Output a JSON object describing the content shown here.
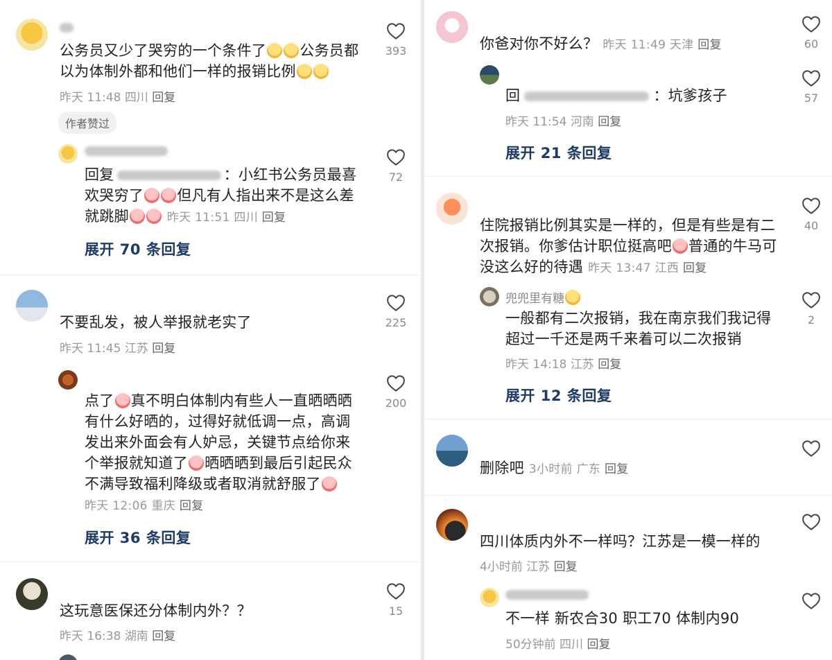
{
  "heart_color": "#444444",
  "expand_color": "#1e3a66",
  "left": {
    "c1": {
      "text": "公务员又少了哭穷的一个条件了",
      "text2": "公务员都以为体制外都和他们一样的报销比例",
      "time": "昨天 11:48",
      "place": "四川",
      "reply": "回复",
      "likes": "393",
      "author_tag": "作者赞过"
    },
    "c1r": {
      "prefix": "回复",
      "text": "：小红书公务员最喜欢哭穷了",
      "text2": "但凡有人指出来不是这么差就跳脚",
      "time": "昨天 11:51",
      "place": "四川",
      "reply": "回复",
      "likes": "72",
      "expand": "展开 70 条回复"
    },
    "c2": {
      "text": "不要乱发，被人举报就老实了",
      "time": "昨天 11:45",
      "place": "江苏",
      "reply": "回复",
      "likes": "225"
    },
    "c2r": {
      "text_a": "点了",
      "text_b": "真不明白体制内有些人一直晒晒晒有什么好晒的，过得好就低调一点，高调发出来外面会有人妒忌，关键节点给你来个举报就知道了",
      "text_c": "晒晒晒到最后引起民众不满导致福利降级或者取消就舒服了",
      "time": "昨天 12:06",
      "place": "重庆",
      "reply": "回复",
      "likes": "200",
      "expand": "展开 36 条回复"
    },
    "c3": {
      "text": "这玩意医保还分体制内外？？",
      "time": "昨天 16:38",
      "place": "湖南",
      "reply": "回复",
      "likes": "15"
    }
  },
  "right": {
    "c1": {
      "text": "你爸对你不好么？",
      "time": "昨天 11:49",
      "place": "天津",
      "reply": "回复",
      "likes": "60"
    },
    "c1r": {
      "prefix": "回",
      "text": "：坑爹孩子",
      "time": "昨天 11:54",
      "place": "河南",
      "reply": "回复",
      "likes": "57",
      "expand": "展开 21 条回复"
    },
    "c2": {
      "text": "住院报销比例其实是一样的，但是有些是有二次报销。你爹估计职位挺高吧",
      "text2": "普通的牛马可没这么好的待遇",
      "time": "昨天 13:47",
      "place": "江西",
      "reply": "回复",
      "likes": "40"
    },
    "c2r": {
      "name": "兜兜里有糖",
      "text": "一般都有二次报销，我在南京我们我记得超过一千还是两千来着可以二次报销",
      "time": "昨天 14:18",
      "place": "江苏",
      "reply": "回复",
      "likes": "2",
      "expand": "展开 12 条回复"
    },
    "c3": {
      "text": "删除吧",
      "time": "3小时前",
      "place": "广东",
      "reply": "回复"
    },
    "c4": {
      "text": "四川体质内外不一样吗？江苏是一模一样的",
      "time": "4小时前",
      "place": "江苏",
      "reply": "回复"
    },
    "c4r": {
      "text": "不一样 新农合30 职工70 体制内90",
      "time": "50分钟前",
      "place": "四川",
      "reply": "回复"
    }
  }
}
